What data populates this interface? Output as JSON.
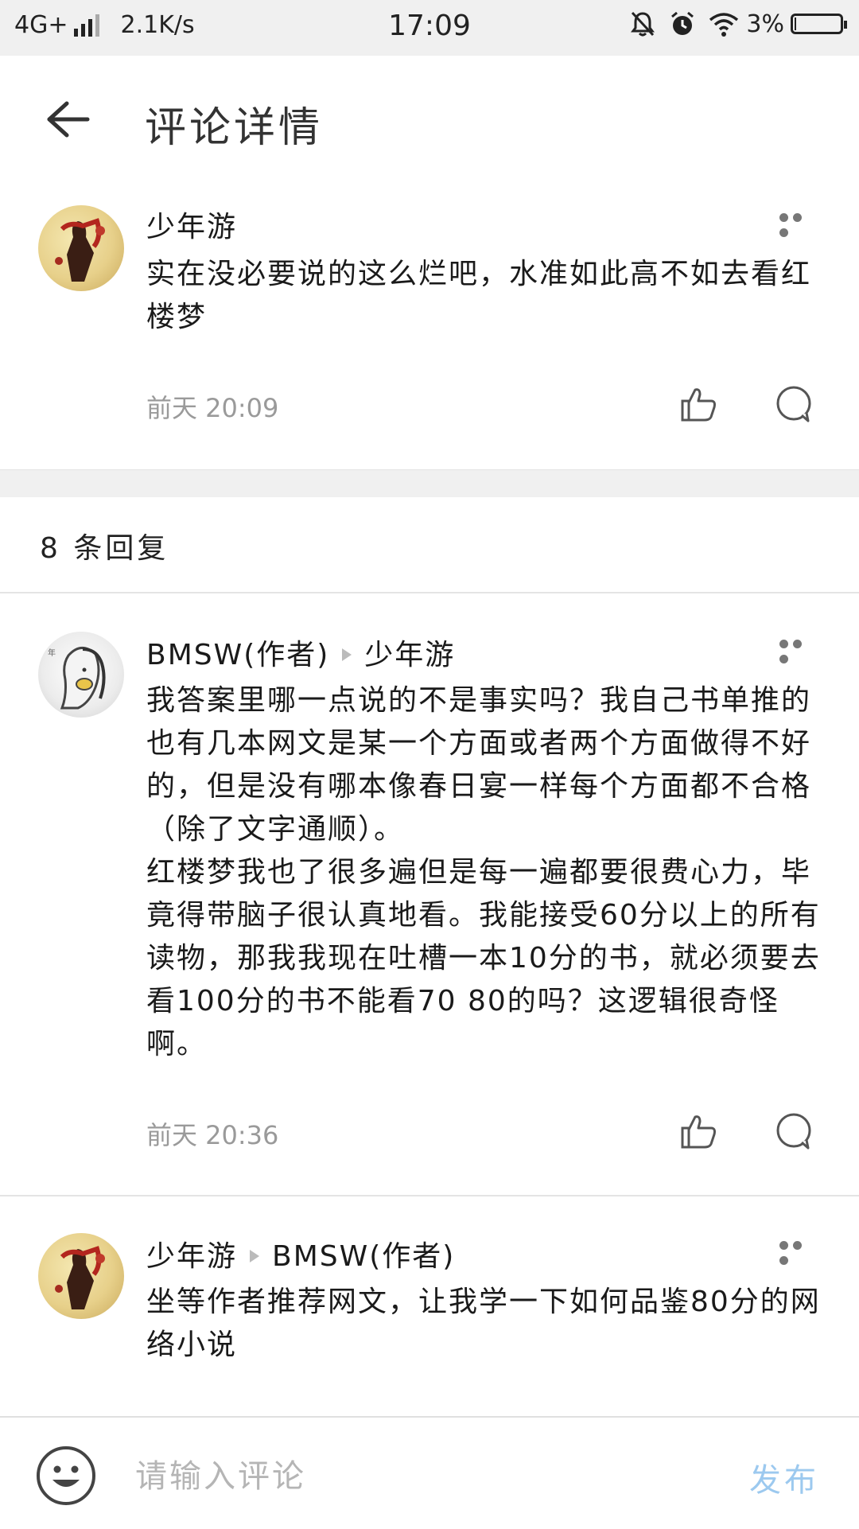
{
  "status_bar": {
    "network": "4G+",
    "speed": "2.1K/s",
    "time": "17:09",
    "battery": "3%",
    "battery_level": 0.03
  },
  "header": {
    "title": "评论详情",
    "back_icon": "back-arrow-icon"
  },
  "main_comment": {
    "author": "少年游",
    "text": "实在没必要说的这么烂吧，水准如此高不如去看红楼梦",
    "time": "前天 20:09"
  },
  "replies_header": "8 条回复",
  "replies": [
    {
      "author": "BMSW(作者)",
      "reply_to": "少年游",
      "text": "我答案里哪一点说的不是事实吗？我自己书单推的也有几本网文是某一个方面或者两个方面做得不好的，但是没有哪本像春日宴一样每个方面都不合格（除了文字通顺）。\n红楼梦我也了很多遍但是每一遍都要很费心力，毕竟得带脑子很认真地看。我能接受60分以上的所有读物，那我我现在吐槽一本10分的书，就必须要去看100分的书不能看70 80的吗？这逻辑很奇怪啊。",
      "time": "前天 20:36"
    },
    {
      "author": "少年游",
      "reply_to": "BMSW(作者)",
      "text": "坐等作者推荐网文，让我学一下如何品鉴80分的网络小说"
    }
  ],
  "bottom_bar": {
    "placeholder": "请输入评论",
    "publish_label": "发布"
  },
  "colors": {
    "publish": "#9cc9ef",
    "meta": "#9a9a9a",
    "divider": "#f0f0f0"
  }
}
